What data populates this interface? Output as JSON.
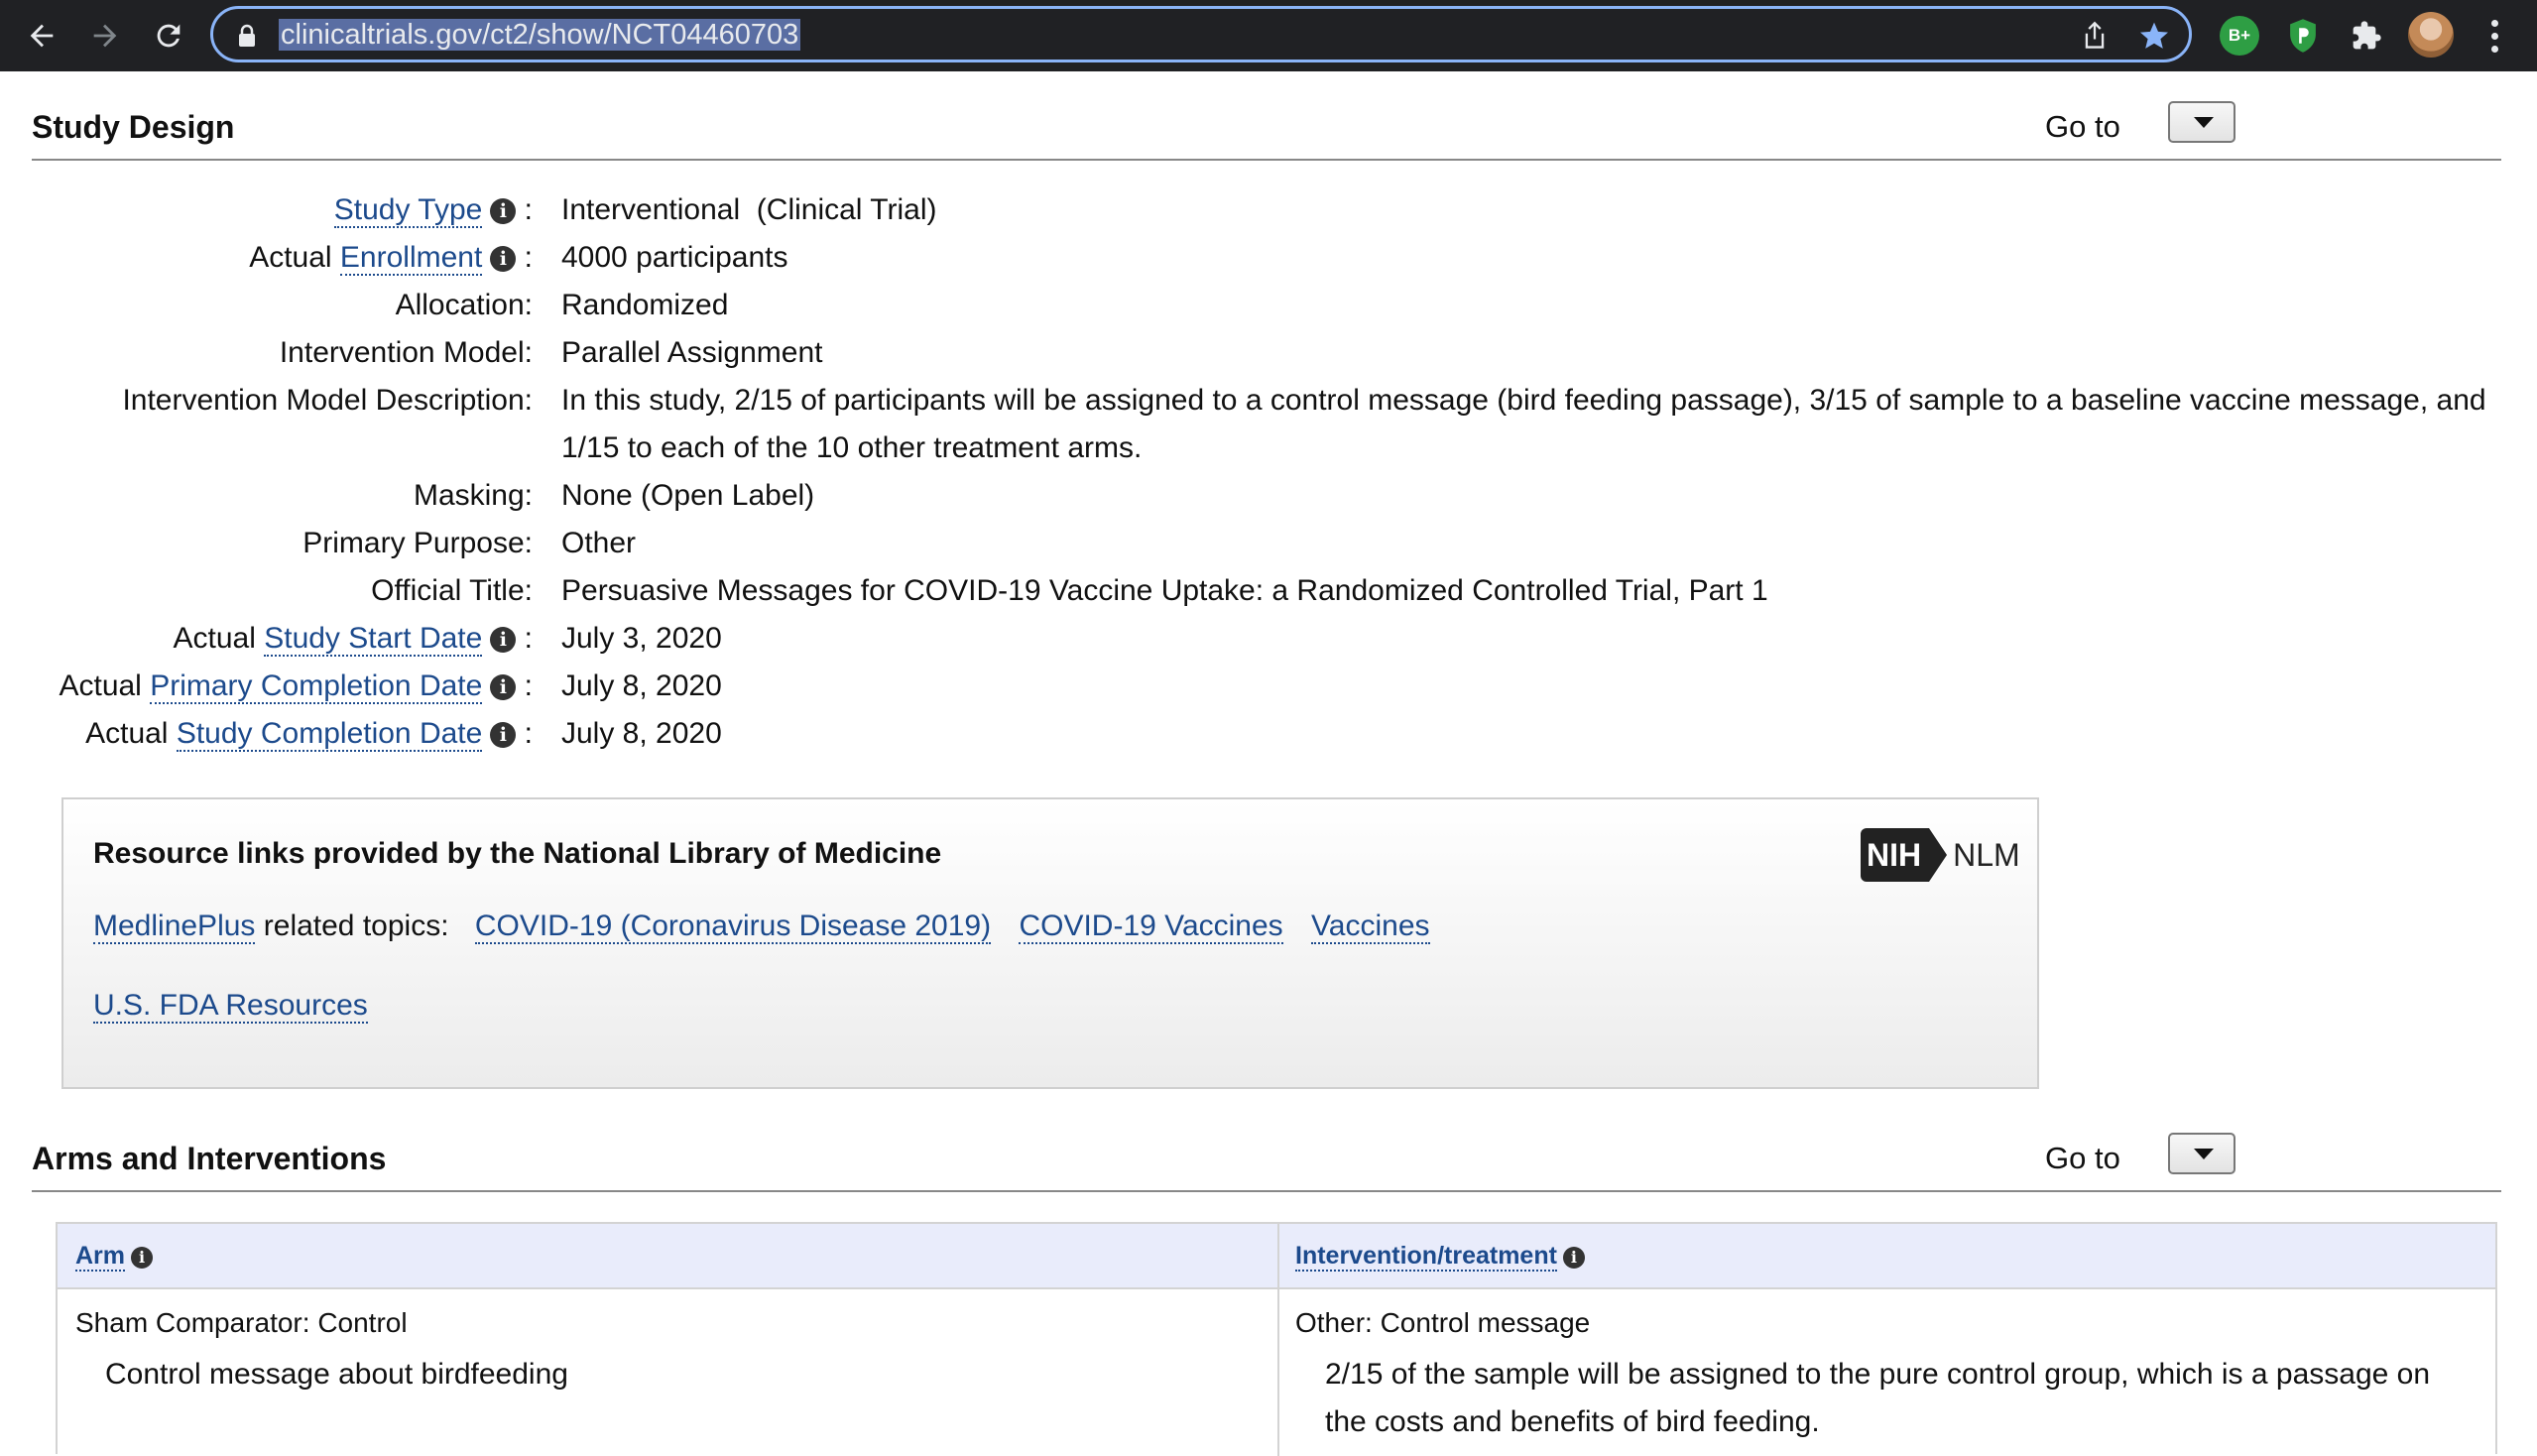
{
  "browser": {
    "url": "clinicaltrials.gov/ct2/show/NCT04460703",
    "extension_badge": "B+"
  },
  "study_design": {
    "title": "Study Design",
    "goto_label": "Go to",
    "rows": {
      "study_type": {
        "label": "Study Type",
        "value": "Interventional  (Clinical Trial)"
      },
      "enrollment": {
        "prefix": "Actual",
        "label": "Enrollment",
        "value": "4000 participants"
      },
      "allocation": {
        "label": "Allocation:",
        "value": "Randomized"
      },
      "intervention_model": {
        "label": "Intervention Model:",
        "value": "Parallel Assignment"
      },
      "intervention_model_description": {
        "label": "Intervention Model Description:",
        "value": "In this study, 2/15 of participants will be assigned to a control message (bird feeding passage), 3/15 of sample to a baseline vaccine message, and 1/15 to each of the 10 other treatment arms."
      },
      "masking": {
        "label": "Masking:",
        "value": "None (Open Label)"
      },
      "primary_purpose": {
        "label": "Primary Purpose:",
        "value": "Other"
      },
      "official_title": {
        "label": "Official Title:",
        "value": "Persuasive Messages for COVID-19 Vaccine Uptake: a Randomized Controlled Trial, Part 1"
      },
      "study_start_date": {
        "prefix": "Actual",
        "label": "Study Start Date",
        "value": "July 3, 2020"
      },
      "primary_completion_date": {
        "prefix": "Actual",
        "label": "Primary Completion Date",
        "value": "July 8, 2020"
      },
      "study_completion_date": {
        "prefix": "Actual",
        "label": "Study Completion Date",
        "value": "July 8, 2020"
      }
    }
  },
  "resources": {
    "title": "Resource links provided by the National Library of Medicine",
    "logo_left": "NIH",
    "logo_right": "NLM",
    "medlineplus": "MedlinePlus",
    "related_topics_label": "related topics:",
    "topics": [
      "COVID-19 (Coronavirus Disease 2019)",
      "COVID-19 Vaccines",
      "Vaccines"
    ],
    "fda_link": "U.S. FDA Resources"
  },
  "arms": {
    "title": "Arms and Interventions",
    "goto_label": "Go to",
    "columns": [
      "Arm",
      "Intervention/treatment"
    ],
    "rows": [
      {
        "arm_title": "Sham Comparator: Control",
        "arm_description": "Control message about birdfeeding",
        "intervention_title": "Other: Control message",
        "intervention_description": "2/15 of the sample will be assigned to the pure control group, which is a passage on the costs and benefits of bird feeding."
      }
    ]
  }
}
